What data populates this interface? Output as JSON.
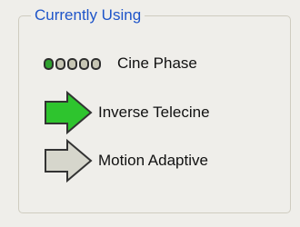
{
  "group": {
    "title": "Currently Using"
  },
  "modes": {
    "cine_phase": {
      "label": "Cine Phase",
      "dot_count": 5,
      "active_dots": 1,
      "dot_active_color": "#2ea12e",
      "dot_inactive_color": "#c7c6b4"
    },
    "inverse_telecine": {
      "label": "Inverse Telecine",
      "icon": "right-arrow-icon",
      "active": true,
      "color": "#2ec42e"
    },
    "motion_adaptive": {
      "label": "Motion Adaptive",
      "icon": "right-arrow-icon",
      "active": false,
      "color": "#d6d6cc"
    }
  }
}
